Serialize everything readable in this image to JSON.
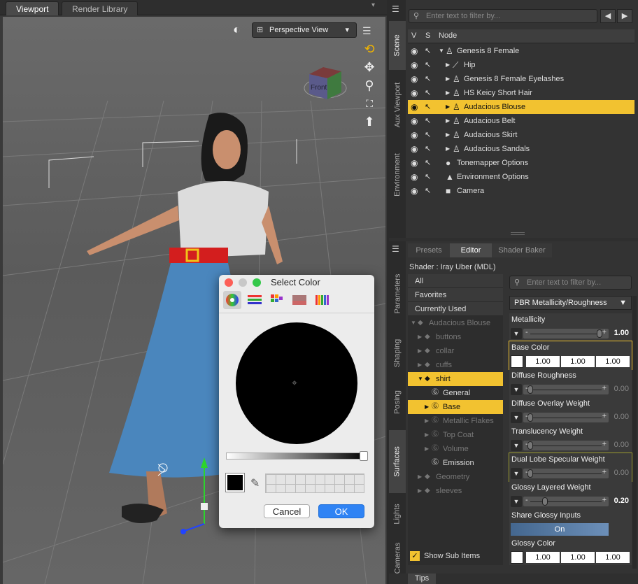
{
  "viewport": {
    "tabs": [
      "Viewport",
      "Render Library"
    ],
    "camera_select": "Perspective View",
    "cube_label": "Front"
  },
  "dialog": {
    "title": "Select Color",
    "cancel": "Cancel",
    "ok": "OK"
  },
  "scene": {
    "vtabs": [
      "Scene",
      "Aux Viewport",
      "Environment"
    ],
    "filter_placeholder": "Enter text to filter by...",
    "col_v": "V",
    "col_s": "S",
    "col_node": "Node",
    "nodes": [
      "Genesis 8 Female",
      "Hip",
      "Genesis 8 Female Eyelashes",
      "HS Keicy Short Hair",
      "Audacious Blouse",
      "Audacious Belt",
      "Audacious Skirt",
      "Audacious Sandals",
      "Tonemapper Options",
      "Environment Options",
      "Camera"
    ]
  },
  "editor": {
    "tabs": [
      "Presets",
      "Editor",
      "Shader Baker"
    ],
    "shader": "Shader : Iray Uber (MDL)",
    "vtabs": [
      "Parameters",
      "Shaping",
      "Posing",
      "Surfaces",
      "Lights",
      "Cameras"
    ],
    "filters": [
      "All",
      "Favorites",
      "Currently Used"
    ],
    "surfaces": [
      "Audacious Blouse",
      "buttons",
      "collar",
      "cuffs",
      "shirt",
      "General",
      "Base",
      "Metallic Flakes",
      "Top Coat",
      "Volume",
      "Emission",
      "Geometry",
      "sleeves"
    ],
    "show_sub": "Show Sub Items",
    "filter_placeholder": "Enter text to filter by...",
    "workflow": "PBR Metallicity/Roughness",
    "props": [
      {
        "label": "Metallicity",
        "value": "1.00",
        "pos": 0.95
      },
      {
        "label": "Base Color",
        "r": "1.00",
        "g": "1.00",
        "b": "1.00"
      },
      {
        "label": "Diffuse Roughness",
        "value": "0.00",
        "pos": 0.0
      },
      {
        "label": "Diffuse Overlay Weight",
        "value": "0.00",
        "pos": 0.0
      },
      {
        "label": "Translucency Weight",
        "value": "0.00",
        "pos": 0.0
      },
      {
        "label": "Dual Lobe Specular Weight",
        "value": "0.00",
        "pos": 0.0
      },
      {
        "label": "Glossy Layered Weight",
        "value": "0.20",
        "pos": 0.2
      },
      {
        "label": "Share Glossy Inputs",
        "toggle": "On"
      },
      {
        "label": "Glossy Color",
        "r": "1.00",
        "g": "1.00",
        "b": "1.00"
      }
    ],
    "bottom_tab": "Tips"
  },
  "colors": {
    "accent": "#f2c230",
    "ok_blue": "#2f83f4"
  }
}
